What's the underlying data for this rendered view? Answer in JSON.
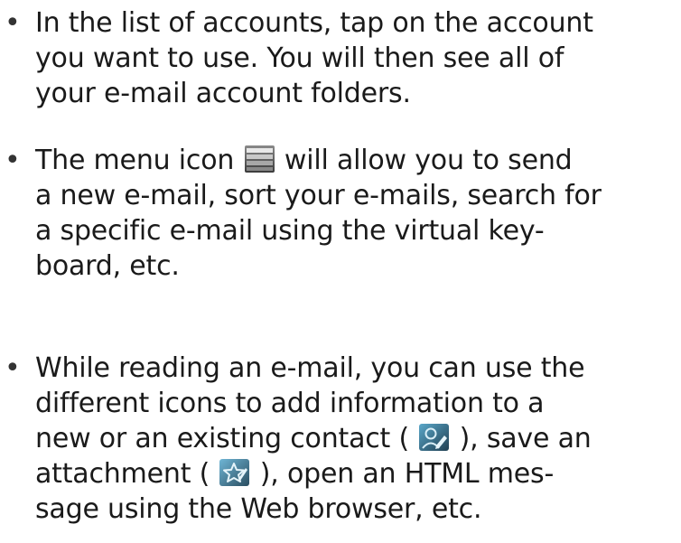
{
  "bullet_glyph": "•",
  "items": [
    {
      "lines": [
        "In the list of accounts, tap on the account",
        "you want to use. You will then see all of",
        "your e-mail account folders."
      ]
    },
    {
      "line1_before": "The menu icon",
      "line1_after": "will allow you to send",
      "lines_rest": [
        "a new e-mail, sort your e-mails, search for",
        "a specific e-mail using the virtual key-",
        "board, etc."
      ]
    },
    {
      "lines_start": [
        "While reading an e-mail, you can use the",
        "different icons to add information to a"
      ],
      "line3_before": "new or an existing contact (",
      "line3_after": "), save an",
      "line4_before": "attachment (",
      "line4_after": "), open  an HTML mes-",
      "line5": "sage using the Web browser, etc."
    }
  ],
  "icons": {
    "menu": "menu-icon",
    "contact": "add-contact-icon",
    "attachment": "save-attachment-icon"
  },
  "colors": {
    "text": "#1a1a1a",
    "icon_dark": "#2f4a5a",
    "icon_light": "#6fb6d6"
  }
}
